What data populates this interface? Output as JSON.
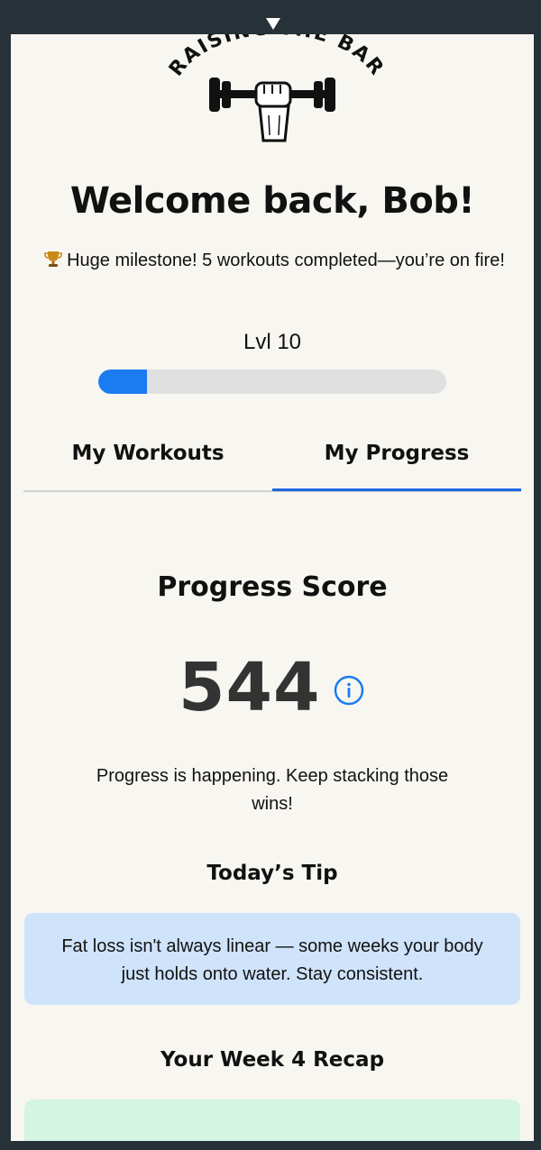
{
  "app": {
    "logo_text": "RAISING THE BAR"
  },
  "header": {
    "welcome": "Welcome back, Bob!",
    "milestone": "Huge milestone! 5 workouts completed—you’re on fire!",
    "level_label": "Lvl 10",
    "level_progress_percent": 14
  },
  "tabs": [
    {
      "label": "My Workouts",
      "active": false
    },
    {
      "label": "My Progress",
      "active": true
    }
  ],
  "progress": {
    "title": "Progress Score",
    "score": "544",
    "message": "Progress is happening. Keep stacking those wins!"
  },
  "tip": {
    "title": "Today’s Tip",
    "text": "Fat loss isn't always linear — some weeks your body just holds onto water. Stay consistent."
  },
  "recap": {
    "title": "Your Week 4 Recap"
  },
  "colors": {
    "accent": "#1a7cf0",
    "tip_bg": "#cfe3fb",
    "recap_bg": "#d4f5e4",
    "page_bg": "#f8f6f1"
  }
}
